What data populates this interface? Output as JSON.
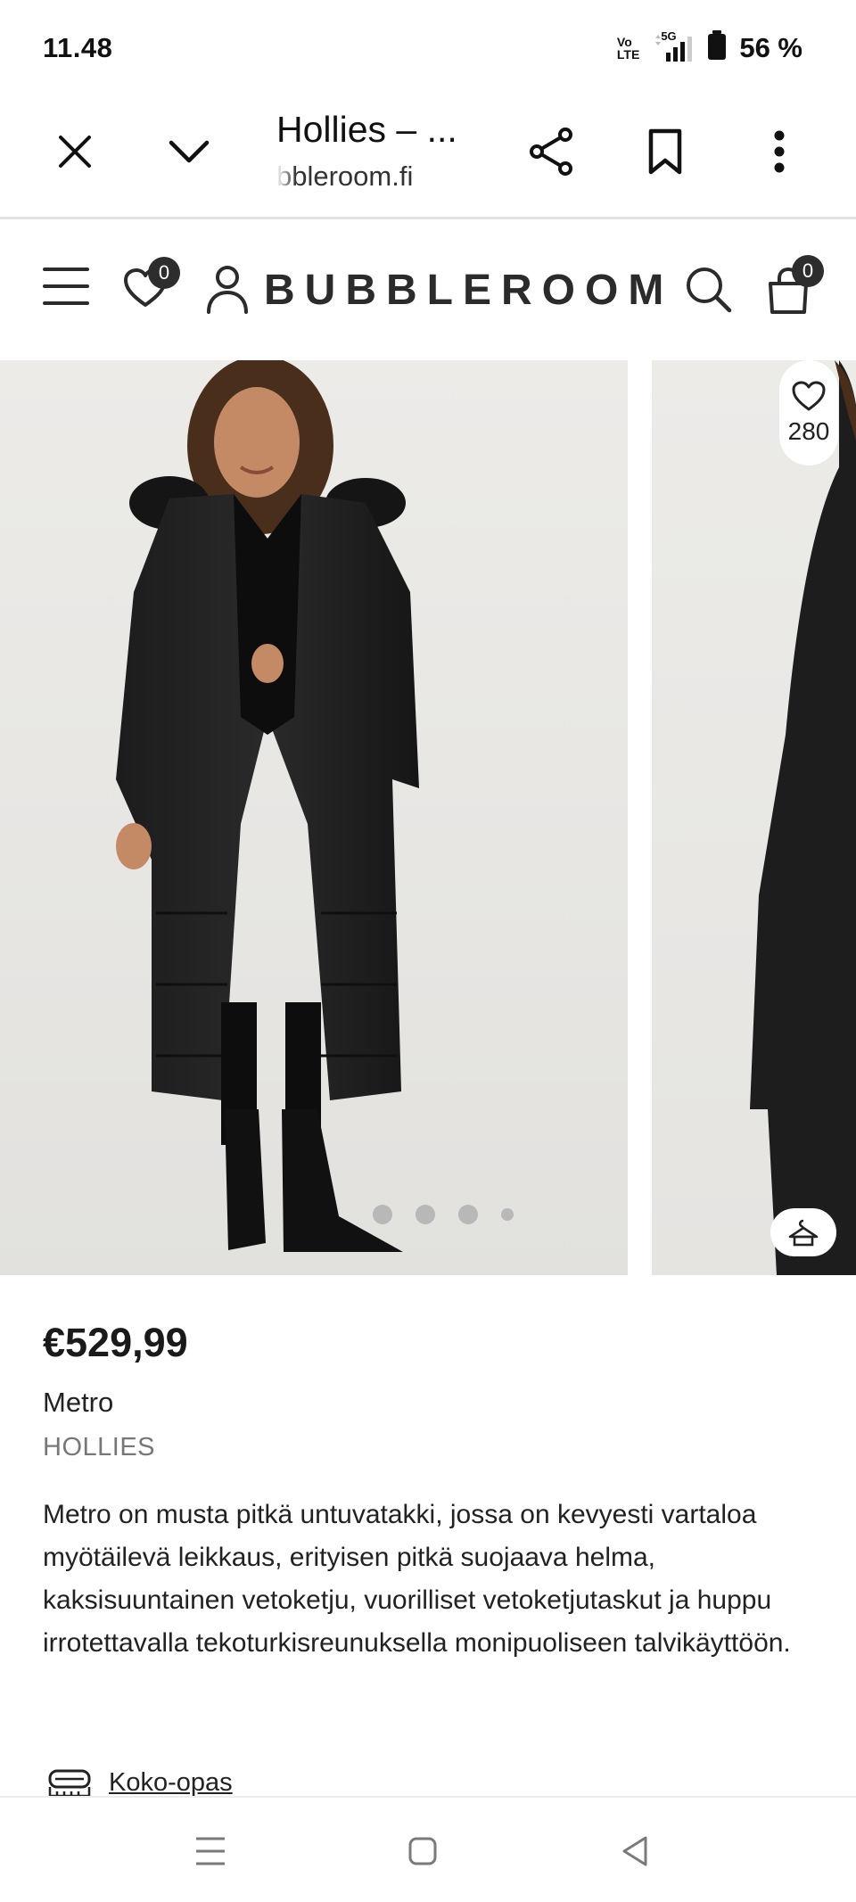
{
  "status_bar": {
    "time": "11.48",
    "volte_top": "Vo",
    "volte_bottom": "LTE",
    "network": "5G",
    "battery": "56 %"
  },
  "browser": {
    "tab_title": "Hollies – ...",
    "url": "bbleroom.fi",
    "icons": [
      "close-icon",
      "chevron-down-icon",
      "share-icon",
      "bookmark-icon",
      "more-vert-icon"
    ]
  },
  "site_header": {
    "brand": "BUBBLEROOM",
    "wishlist_count": "0",
    "cart_count": "0",
    "icons": [
      "menu-icon",
      "heart-icon",
      "account-icon",
      "search-icon",
      "bag-icon"
    ]
  },
  "gallery": {
    "like_count": "280",
    "dot_count": 4,
    "active_dot": 0
  },
  "product": {
    "price": "€529,99",
    "name": "Metro",
    "brand": "HOLLIES",
    "description": "Metro on musta pitkä untuvatakki, jossa on kevyesti vartaloa myötäilevä leikkaus, erityisen pitkä suojaava helma, kaksisuuntainen vetoketju, vuorilliset vetoketjutaskut ja huppu irrotettavalla tekoturkisreunuksella monipuoliseen talvikäyttöön.",
    "size_guide": "Koko-opas"
  },
  "colors": {
    "text": "#1a1a1a",
    "muted": "#777777",
    "badge": "#2d2d2d",
    "photo_bg": "#e8e7e4"
  }
}
